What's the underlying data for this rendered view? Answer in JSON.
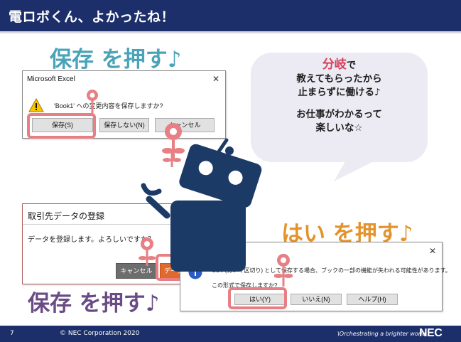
{
  "header": {
    "title": "電ロボくん、よかったね！"
  },
  "labels": {
    "save_top": "保存 を押す♪",
    "yes": "はい を押す♪",
    "save_bottom": "保存 を押す♪"
  },
  "bubble": {
    "accent": "分岐",
    "line1_suffix": "で",
    "line2": "教えてもらったから",
    "line3": "止まらずに働ける♪",
    "line4": "お仕事がわかるって",
    "line5": "楽しいな☆"
  },
  "excel_dialog": {
    "title": "Microsoft Excel",
    "close": "✕",
    "message": "'Book1' への変更内容を保存しますか?",
    "buttons": [
      "保存(S)",
      "保存しない(N)",
      "キャンセル"
    ]
  },
  "register_dialog": {
    "title": "取引先データの登録",
    "message": "データを登録します。よろしいですか？",
    "buttons": [
      "キャンセル",
      "データ"
    ]
  },
  "csv_dialog": {
    "close": "✕",
    "message": "CSV (カンマ区切り) として保存する場合、ブックの一部の機能が失われる可能性があります。",
    "message2": "この形式で保存しますか?",
    "buttons": [
      "はい(Y)",
      "いいえ(N)",
      "ヘルプ(H)"
    ]
  },
  "footer": {
    "page": "7",
    "copyright": "© NEC Corporation 2020",
    "tagline": "\\Orchestrating a brighter world",
    "logo": "NEC"
  },
  "colors": {
    "navy": "#1c2f6b",
    "teal": "#4aa3b9",
    "orange": "#e4932c",
    "purple": "#6a4b86",
    "pink": "#e77f84",
    "robot": "#1c3a66"
  }
}
